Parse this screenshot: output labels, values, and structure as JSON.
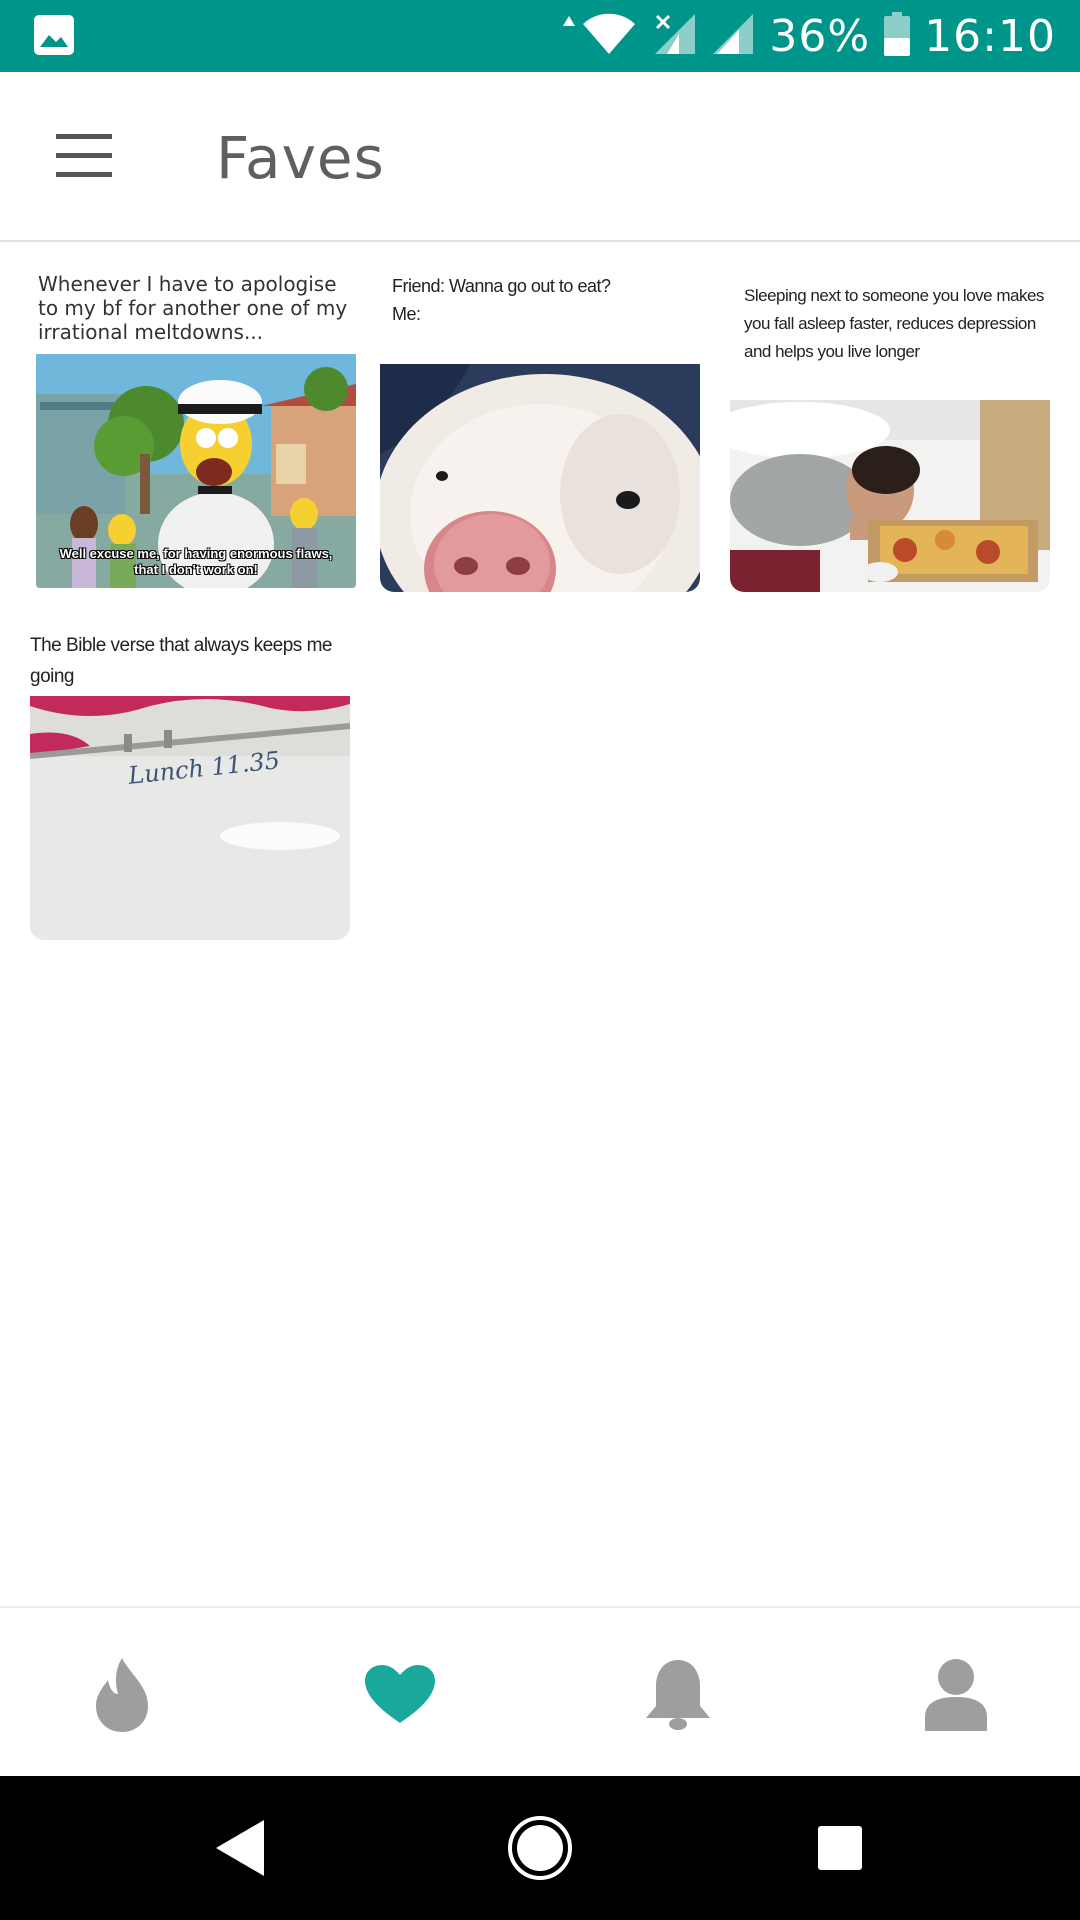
{
  "status_bar": {
    "battery": "36%",
    "time": "16:10",
    "icons": [
      "gallery-icon",
      "wifi-icon",
      "signal-no-sim-icon",
      "signal-icon",
      "battery-icon"
    ]
  },
  "app_bar": {
    "menu_icon": "hamburger-menu-icon",
    "title": "Faves"
  },
  "cards": [
    {
      "caption": "Whenever I have to apologise to my bf for another one of my irrational meltdowns...",
      "subtitle_line1": "Well excuse me, for having enormous flaws,",
      "subtitle_line2": "that I don't work on!"
    },
    {
      "caption_line1": "Friend: Wanna go out to eat?",
      "caption_line2": "Me:"
    },
    {
      "caption": "Sleeping next to someone you love makes you fall asleep faster, reduces depression and helps you live longer"
    },
    {
      "caption": "The Bible verse that always keeps me going",
      "board_text": "Lunch 11.35"
    }
  ],
  "bottom_nav": {
    "items": [
      {
        "icon": "flame-icon",
        "active": false,
        "color": "#9e9e9e"
      },
      {
        "icon": "heart-icon",
        "active": true,
        "color": "#1aa89c"
      },
      {
        "icon": "bell-icon",
        "active": false,
        "color": "#9e9e9e"
      },
      {
        "icon": "profile-icon",
        "active": false,
        "color": "#9e9e9e"
      }
    ]
  },
  "system_nav": {
    "buttons": [
      "back-icon",
      "home-icon",
      "recents-icon"
    ]
  },
  "colors": {
    "status_bar": "#00958a",
    "accent": "#1aa89c",
    "inactive": "#9e9e9e"
  }
}
